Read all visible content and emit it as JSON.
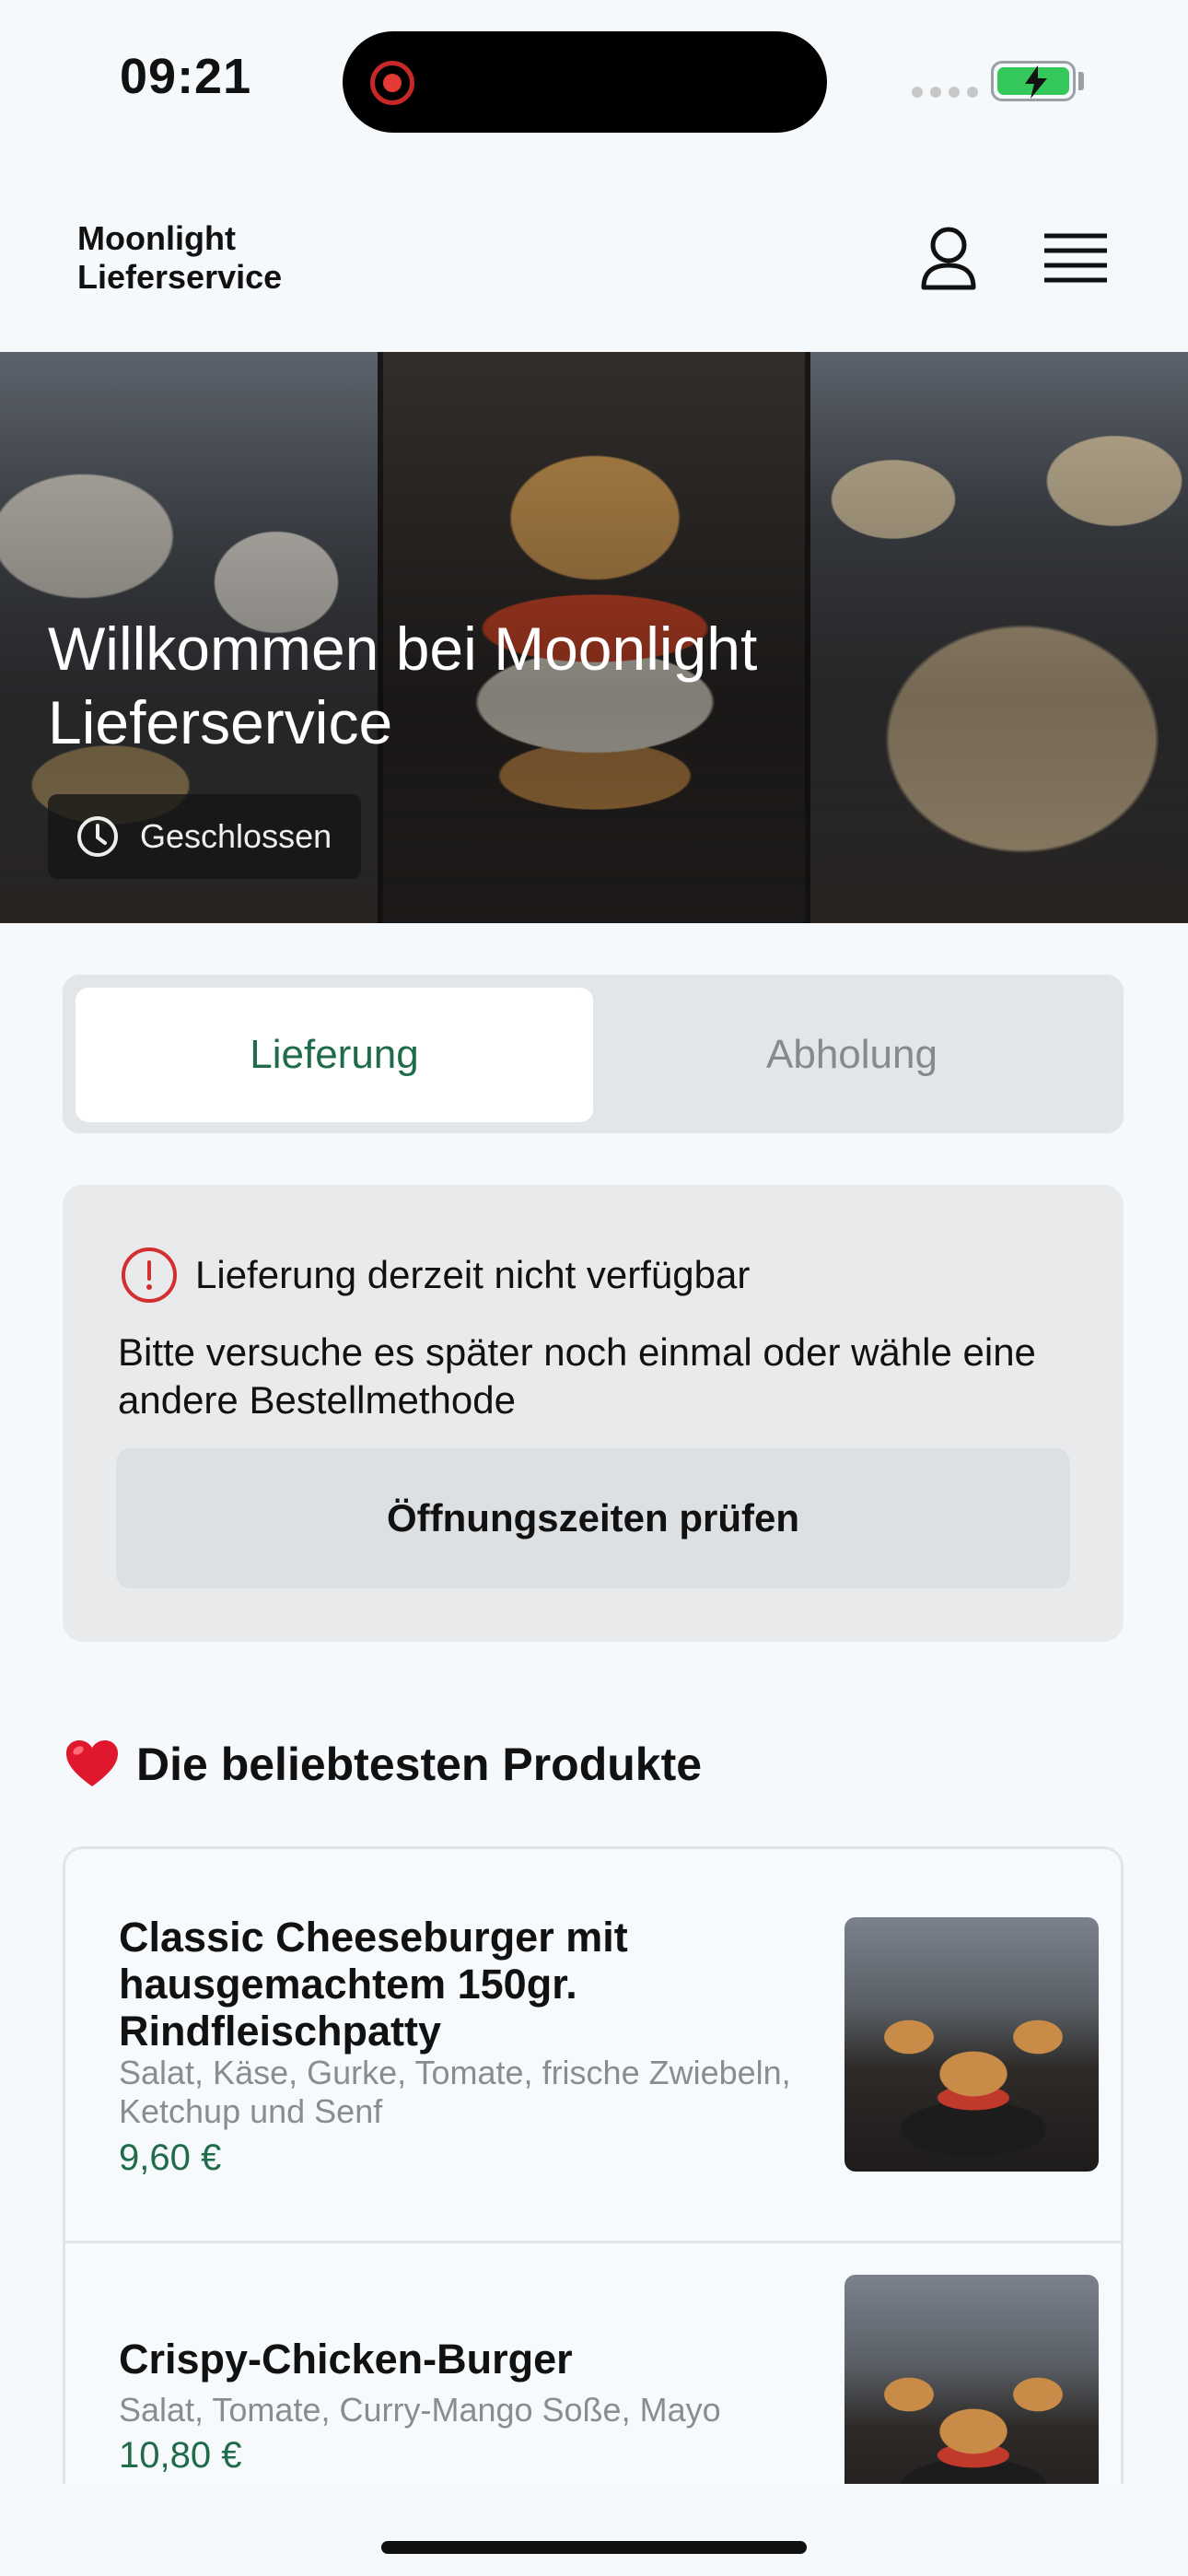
{
  "status_bar": {
    "time": "09:21"
  },
  "header": {
    "brand": "Moonlight Lieferservice",
    "user_icon": "user-icon",
    "menu_icon": "menu-icon"
  },
  "hero": {
    "title": "Willkommen bei Moonlight Lieferservice",
    "status": "Geschlossen",
    "status_icon": "clock-icon"
  },
  "tabs": {
    "delivery": "Lieferung",
    "pickup": "Abholung",
    "selected": "Lieferung"
  },
  "notice": {
    "title": "Lieferung derzeit nicht verfügbar",
    "text": "Bitte versuche es später noch einmal oder wähle eine andere Bestellmethode",
    "button": "Öffnungszeiten prüfen",
    "icon": "info-icon",
    "accent": "#d32f2f"
  },
  "popular": {
    "emoji": "❤️",
    "title": "Die beliebtesten Produkte",
    "products": [
      {
        "name": "Classic Cheeseburger mit hausgemachtem 150gr. Rindfleischpatty",
        "description": "Salat, Käse, Gurke, Tomate, frische Zwiebeln, Ketchup und Senf",
        "price": "9,60 €"
      },
      {
        "name": "Crispy-Chicken-Burger",
        "description": "Salat, Tomate, Curry-Mango Soße, Mayo",
        "price": "10,80 €"
      }
    ]
  },
  "colors": {
    "brand_green": "#1f6b4a",
    "background": "#f5f9fc"
  }
}
